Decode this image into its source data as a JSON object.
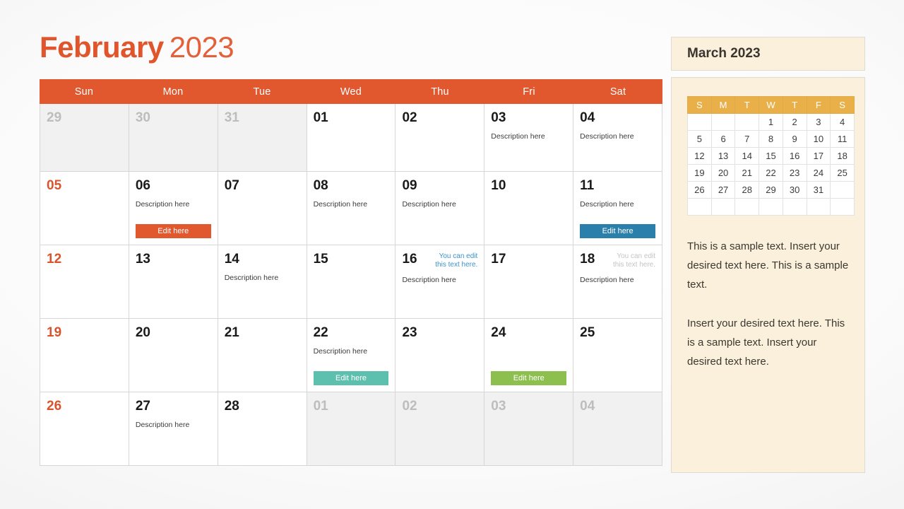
{
  "title": {
    "month": "February",
    "year": "2023"
  },
  "calendar": {
    "weekdays": [
      "Sun",
      "Mon",
      "Tue",
      "Wed",
      "Thu",
      "Fri",
      "Sat"
    ],
    "weeks": [
      [
        {
          "num": "29",
          "muted": true
        },
        {
          "num": "30",
          "muted": true
        },
        {
          "num": "31",
          "muted": true
        },
        {
          "num": "01"
        },
        {
          "num": "02"
        },
        {
          "num": "03",
          "desc": "Description here"
        },
        {
          "num": "04",
          "desc": "Description here"
        }
      ],
      [
        {
          "num": "05",
          "sunday": true
        },
        {
          "num": "06",
          "desc": "Description here",
          "button": {
            "label": "Edit here",
            "color": "#E1572E"
          }
        },
        {
          "num": "07"
        },
        {
          "num": "08",
          "desc": "Description here"
        },
        {
          "num": "09",
          "desc": "Description here"
        },
        {
          "num": "10"
        },
        {
          "num": "11",
          "desc": "Description here",
          "button": {
            "label": "Edit here",
            "color": "#2B80AB"
          }
        }
      ],
      [
        {
          "num": "12",
          "sunday": true
        },
        {
          "num": "13"
        },
        {
          "num": "14",
          "desc": "Description here"
        },
        {
          "num": "15"
        },
        {
          "num": "16",
          "note": "You can edit this text here.",
          "note_style": "blue",
          "desc": "Description here"
        },
        {
          "num": "17"
        },
        {
          "num": "18",
          "note": "You can edit this text here.",
          "note_style": "grey",
          "desc": "Description here"
        }
      ],
      [
        {
          "num": "19",
          "sunday": true
        },
        {
          "num": "20"
        },
        {
          "num": "21"
        },
        {
          "num": "22",
          "desc": "Description here",
          "button": {
            "label": "Edit here",
            "color": "#5DBFAE"
          }
        },
        {
          "num": "23"
        },
        {
          "num": "24",
          "button": {
            "label": "Edit here",
            "color": "#8CBF4D"
          }
        },
        {
          "num": "25"
        }
      ],
      [
        {
          "num": "26",
          "sunday": true
        },
        {
          "num": "27",
          "desc": "Description here"
        },
        {
          "num": "28"
        },
        {
          "num": "01",
          "muted": true
        },
        {
          "num": "02",
          "muted": true
        },
        {
          "num": "03",
          "muted": true
        },
        {
          "num": "04",
          "muted": true
        }
      ]
    ]
  },
  "side_panel": {
    "header_title": "March 2023",
    "mini_calendar": {
      "weekdays": [
        "S",
        "M",
        "T",
        "W",
        "T",
        "F",
        "S"
      ],
      "weeks": [
        [
          "",
          "",
          "",
          "1",
          "2",
          "3",
          "4"
        ],
        [
          "5",
          "6",
          "7",
          "8",
          "9",
          "10",
          "11"
        ],
        [
          "12",
          "13",
          "14",
          "15",
          "16",
          "17",
          "18"
        ],
        [
          "19",
          "20",
          "21",
          "22",
          "23",
          "24",
          "25"
        ],
        [
          "26",
          "27",
          "28",
          "29",
          "30",
          "31",
          ""
        ],
        [
          "",
          "",
          "",
          "",
          "",
          "",
          ""
        ]
      ]
    },
    "paragraphs": [
      "This is a sample text. Insert your desired text here. This is a sample text.",
      "Insert your desired text here. This is a sample text. Insert your desired text here."
    ]
  },
  "colors": {
    "accent_orange": "#E1572E",
    "title_orange": "#E0552B",
    "mini_header_amber": "#E9B04A",
    "panel_cream": "#FAF0DC",
    "button_blue": "#2B80AB",
    "button_teal": "#5DBFAE",
    "button_green": "#8CBF4D"
  }
}
